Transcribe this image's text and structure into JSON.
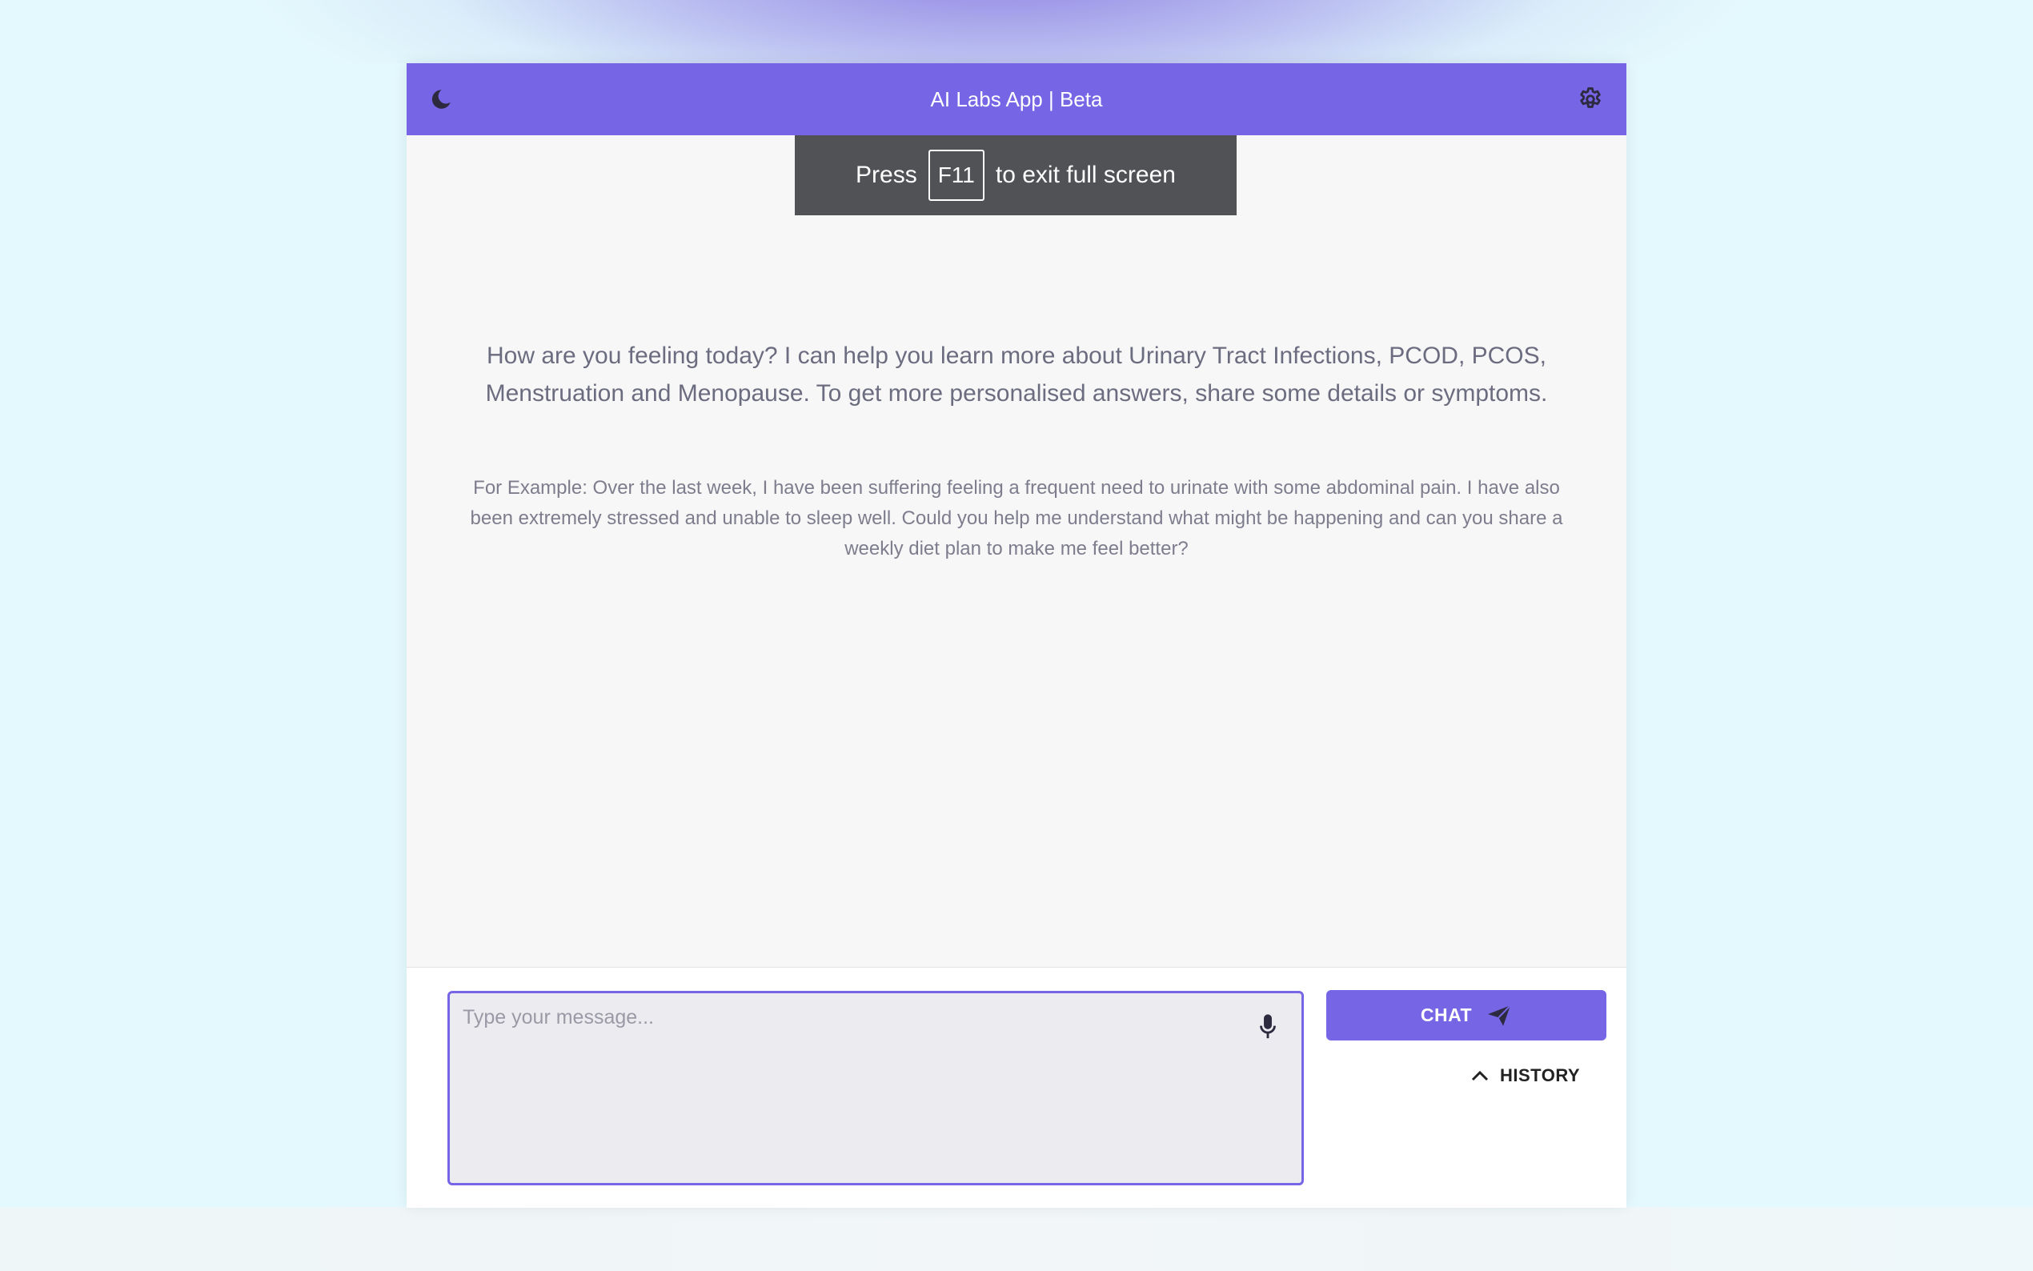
{
  "header": {
    "title": "AI Labs App | Beta",
    "theme_icon": "moon-icon",
    "settings_icon": "gear-icon"
  },
  "fullscreen_notice": {
    "prefix": "Press",
    "key": "F11",
    "suffix": "to exit full screen"
  },
  "main": {
    "welcome": "How are you feeling today? I can help you learn more about Urinary Tract Infections, PCOD, PCOS, Menstruation and Menopause. To get more personalised answers, share some details or symptoms.",
    "example": "For Example: Over the last week, I have been suffering feeling a frequent need to urinate with some abdominal pain. I have also been extremely stressed and unable to sleep well. Could you help me understand what might be happening and can you share a weekly diet plan to make me feel better?"
  },
  "composer": {
    "message_value": "",
    "placeholder": "Type your message...",
    "mic_icon": "microphone-icon",
    "chat_label": "CHAT",
    "send_icon": "paper-plane-icon",
    "history_label": "HISTORY",
    "history_icon": "chevron-up-icon"
  },
  "colors": {
    "accent": "#7666e6",
    "page_background": "#e4f9fd",
    "toast_background": "#505256"
  }
}
